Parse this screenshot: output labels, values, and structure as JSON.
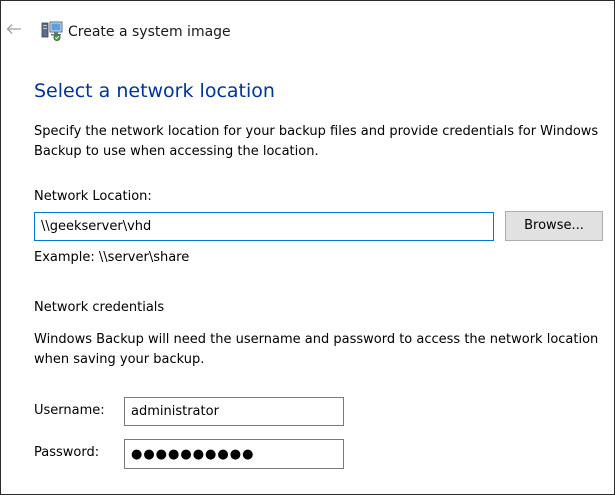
{
  "window": {
    "title": "Create a system image"
  },
  "icons": {
    "back": "arrow-left-icon",
    "app": "system-image-backup-icon"
  },
  "page": {
    "heading": "Select a network location",
    "description": "Specify the network location for your backup files and provide credentials for Windows Backup to use when accessing the location."
  },
  "network_location": {
    "label": "Network Location:",
    "value": "\\\\geekserver\\vhd",
    "browse_label": "Browse...",
    "example": "Example: \\\\server\\share"
  },
  "credentials": {
    "section_title": "Network credentials",
    "description": "Windows Backup will need the username and password to access the network location when saving your backup.",
    "username_label": "Username:",
    "username_value": "administrator",
    "password_label": "Password:",
    "password_mask": "●●●●●●●●●●"
  },
  "colors": {
    "heading": "#003399",
    "focus_border": "#0078d7",
    "button_bg": "#e1e1e1"
  }
}
